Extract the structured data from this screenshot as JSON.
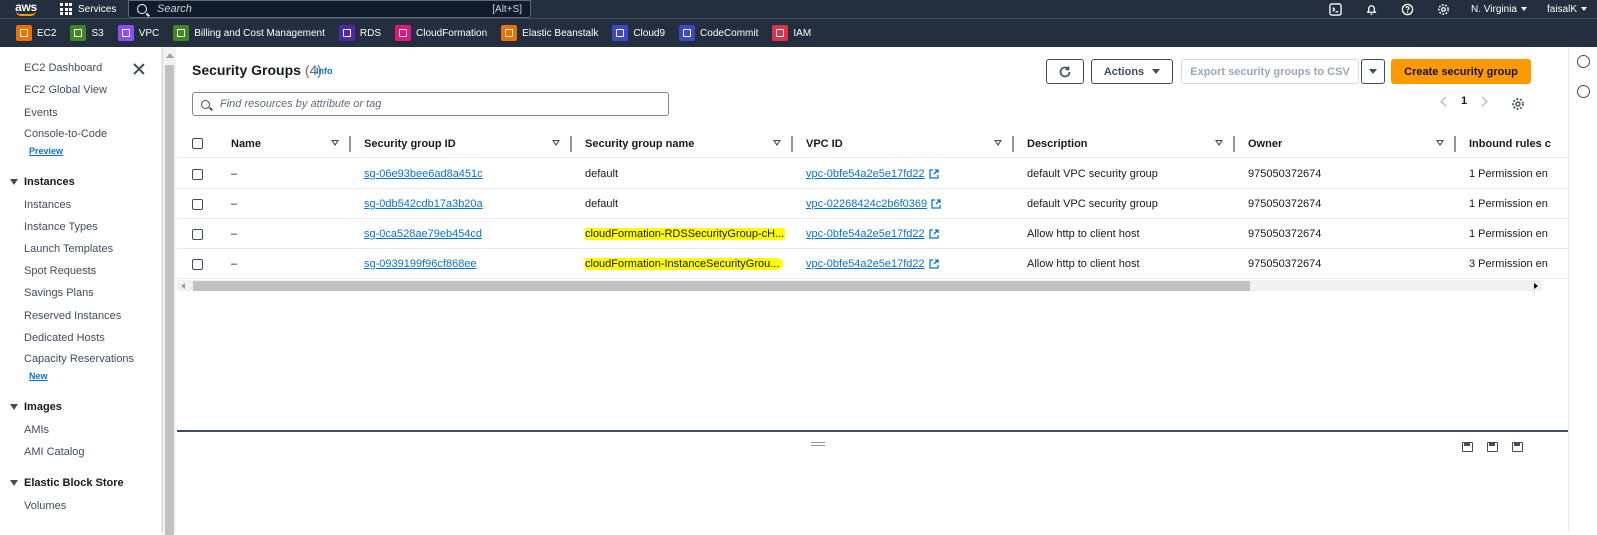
{
  "topnav": {
    "logo": "aws",
    "services_label": "Services",
    "search_placeholder": "Search",
    "search_shortcut": "[Alt+S]",
    "region": "N. Virginia",
    "user": "faisalK"
  },
  "favorites": [
    {
      "label": "EC2",
      "color": "#ed7100",
      "icon": "ec2-icon"
    },
    {
      "label": "S3",
      "color": "#3f8624",
      "icon": "s3-icon"
    },
    {
      "label": "VPC",
      "color": "#8c4fff",
      "icon": "vpc-icon"
    },
    {
      "label": "Billing and Cost Management",
      "color": "#3f8624",
      "icon": "billing-icon"
    },
    {
      "label": "RDS",
      "color": "#4d27aa",
      "icon": "rds-icon"
    },
    {
      "label": "CloudFormation",
      "color": "#e7157b",
      "icon": "cloudformation-icon"
    },
    {
      "label": "Elastic Beanstalk",
      "color": "#ed7100",
      "icon": "beanstalk-icon"
    },
    {
      "label": "Cloud9",
      "color": "#3b48cc",
      "icon": "cloud9-icon"
    },
    {
      "label": "CodeCommit",
      "color": "#3b48cc",
      "icon": "codecommit-icon"
    },
    {
      "label": "IAM",
      "color": "#dd344c",
      "icon": "iam-icon"
    }
  ],
  "sidebar": {
    "ec2_dashboard": "EC2 Dashboard",
    "ec2_global_view": "EC2 Global View",
    "events": "Events",
    "console_to_code": "Console-to-Code",
    "preview_badge": "Preview",
    "instances_section": "Instances",
    "instances": "Instances",
    "instance_types": "Instance Types",
    "launch_templates": "Launch Templates",
    "spot_requests": "Spot Requests",
    "savings_plans": "Savings Plans",
    "reserved_instances": "Reserved Instances",
    "dedicated_hosts": "Dedicated Hosts",
    "capacity_reservations": "Capacity Reservations",
    "new_badge": "New",
    "images_section": "Images",
    "amis": "AMIs",
    "ami_catalog": "AMI Catalog",
    "ebs_section": "Elastic Block Store",
    "volumes": "Volumes"
  },
  "main": {
    "title": "Security Groups",
    "count": "(4)",
    "info": "Info",
    "actions": "Actions",
    "export": "Export security groups to CSV",
    "create": "Create security group",
    "filter_placeholder": "Find resources by attribute or tag",
    "page": "1"
  },
  "table": {
    "columns": [
      "Name",
      "Security group ID",
      "Security group name",
      "VPC ID",
      "Description",
      "Owner",
      "Inbound rules c"
    ],
    "rows": [
      {
        "name": "–",
        "sg_id": "sg-06e93bee6ad8a451c",
        "sg_name": "default",
        "vpc_id": "vpc-0bfe54a2e5e17fd22",
        "description": "default VPC security group",
        "owner": "975050372674",
        "inbound": "1 Permission en",
        "highlight": false
      },
      {
        "name": "–",
        "sg_id": "sg-0db542cdb17a3b20a",
        "sg_name": "default",
        "vpc_id": "vpc-02268424c2b6f0369",
        "description": "default VPC security group",
        "owner": "975050372674",
        "inbound": "1 Permission en",
        "highlight": false
      },
      {
        "name": "–",
        "sg_id": "sg-0ca528ae79eb454cd",
        "sg_name": "cloudFormation-RDSSecurityGroup-cH...",
        "vpc_id": "vpc-0bfe54a2e5e17fd22",
        "description": "Allow http to client host",
        "owner": "975050372674",
        "inbound": "1 Permission en",
        "highlight": true
      },
      {
        "name": "–",
        "sg_id": "sg-0939199f96cf868ee",
        "sg_name": "cloudFormation-InstanceSecurityGrou...",
        "vpc_id": "vpc-0bfe54a2e5e17fd22",
        "description": "Allow http to client host",
        "owner": "975050372674",
        "inbound": "3 Permission en",
        "highlight": true
      }
    ]
  },
  "colors": {
    "nav_bg": "#232f3e",
    "primary_button": "#ff9900",
    "link": "#0972d3",
    "highlight": "#ffff00"
  }
}
